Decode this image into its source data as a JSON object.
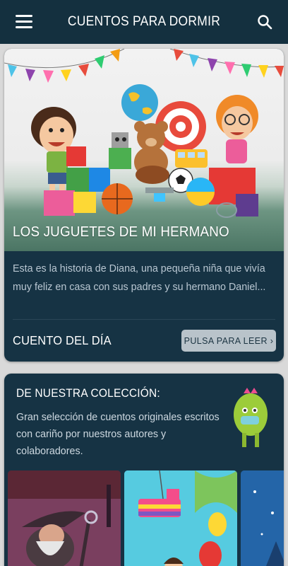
{
  "app": {
    "title": "CUENTOS PARA DORMIR",
    "menu_icon": "hamburger-menu-icon",
    "search_icon": "search-icon",
    "bar_color": "#14303f"
  },
  "featured": {
    "story_title": "LOS JUGUETES DE MI HERMANO",
    "excerpt": "Esta es la historia de Diana, una pequeña niña que vivía muy feliz en casa con sus padres y su hermano Daniel...",
    "section_label": "CUENTO DEL DÍA",
    "read_button": "PULSA PARA LEER ›",
    "card_color": "#163344"
  },
  "collection": {
    "title": "DE NUESTRA COLECCIÓN:",
    "description": "Gran selección de cuentos originales escritos con cariño por nuestros autores y colaboradores.",
    "mascot_icon": "cactus-mascot-icon",
    "thumbnails": [
      {
        "icon": "wizard-illustration"
      },
      {
        "icon": "pinata-party-illustration"
      },
      {
        "icon": "winter-night-illustration"
      }
    ]
  }
}
